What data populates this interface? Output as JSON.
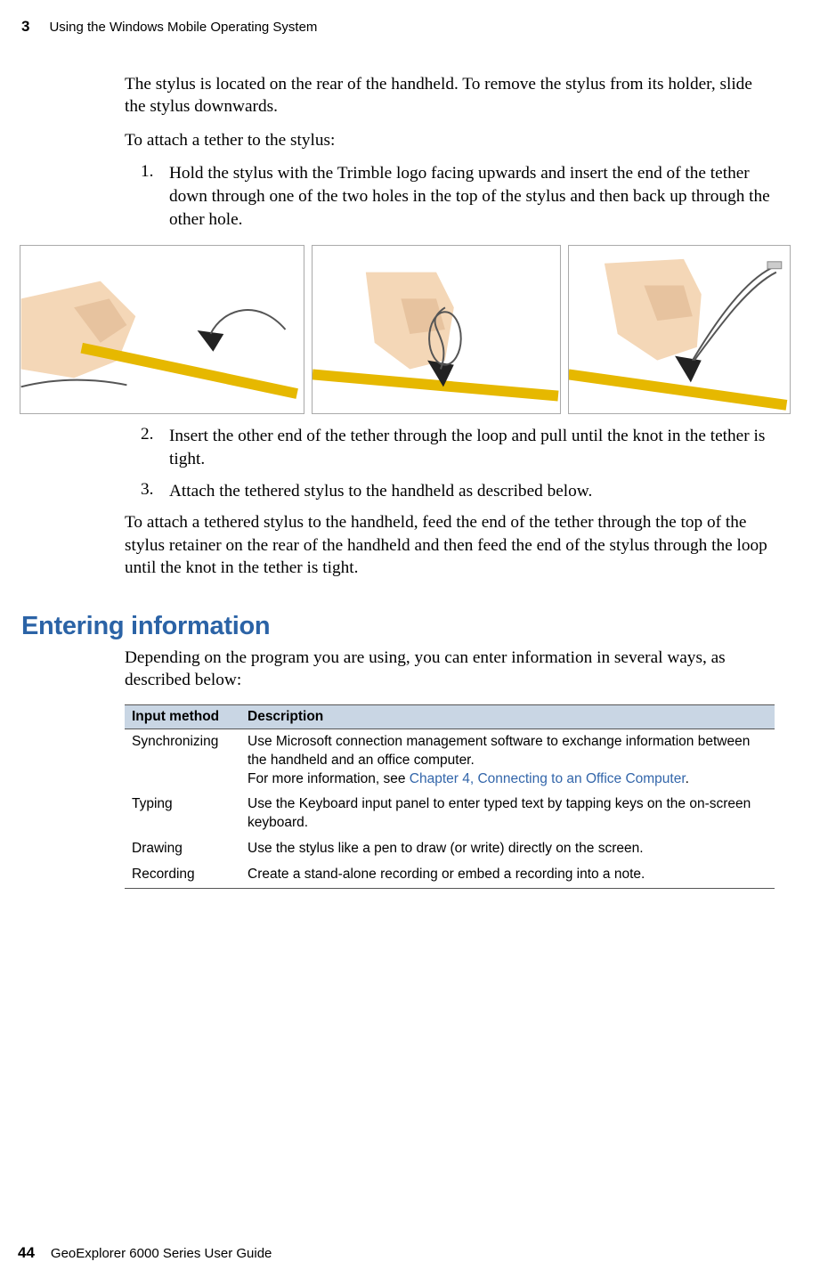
{
  "header": {
    "chapter_number": "3",
    "chapter_title": "Using the Windows Mobile Operating System"
  },
  "intro": {
    "p1": "The stylus is located on the rear of the handheld. To remove the stylus from its holder, slide the stylus downwards.",
    "p2": "To attach a tether to the stylus:"
  },
  "steps_a": {
    "item1_num": "1.",
    "item1_txt": "Hold the stylus with the Trimble logo facing upwards and insert the end of the tether down through one of the two holes in the top of the stylus and then back up through the other hole."
  },
  "images": {
    "img1_alt": "Hand holding stylus, threading tether through first hole",
    "img2_alt": "Hand holding stylus, tether threaded through both holes forming loop",
    "img3_alt": "Hand pulling tether loop tight on stylus"
  },
  "steps_b": {
    "item2_num": "2.",
    "item2_txt": "Insert the other end of the tether through the loop and pull until the knot in the tether is tight.",
    "item3_num": "3.",
    "item3_txt": "Attach the tethered stylus to the handheld as described below."
  },
  "after_steps": {
    "p1": "To attach a tethered stylus to the handheld, feed the end of the tether through the top of the stylus retainer on the rear of the handheld and then feed the end of the stylus through the loop until the knot in the tether is tight."
  },
  "section": {
    "heading": "Entering information",
    "lead": "Depending on the program you are using, you can enter information in several ways, as described below:"
  },
  "table": {
    "head_method": "Input method",
    "head_desc": "Description",
    "rows": [
      {
        "method": "Synchronizing",
        "desc_line1": "Use Microsoft connection management software to exchange information between the handheld and an office computer.",
        "desc_line2_pre": "For more information, see ",
        "desc_line2_link": "Chapter 4, Connecting to an Office Computer",
        "desc_line2_post": "."
      },
      {
        "method": "Typing",
        "desc": "Use the Keyboard input panel to enter typed text by tapping keys on the on-screen keyboard."
      },
      {
        "method": "Drawing",
        "desc": "Use the stylus like a pen to draw (or write) directly on the screen."
      },
      {
        "method": "Recording",
        "desc": "Create a stand-alone recording or embed a recording into a note."
      }
    ]
  },
  "footer": {
    "page_number": "44",
    "doc_title": "GeoExplorer 6000 Series User Guide"
  }
}
